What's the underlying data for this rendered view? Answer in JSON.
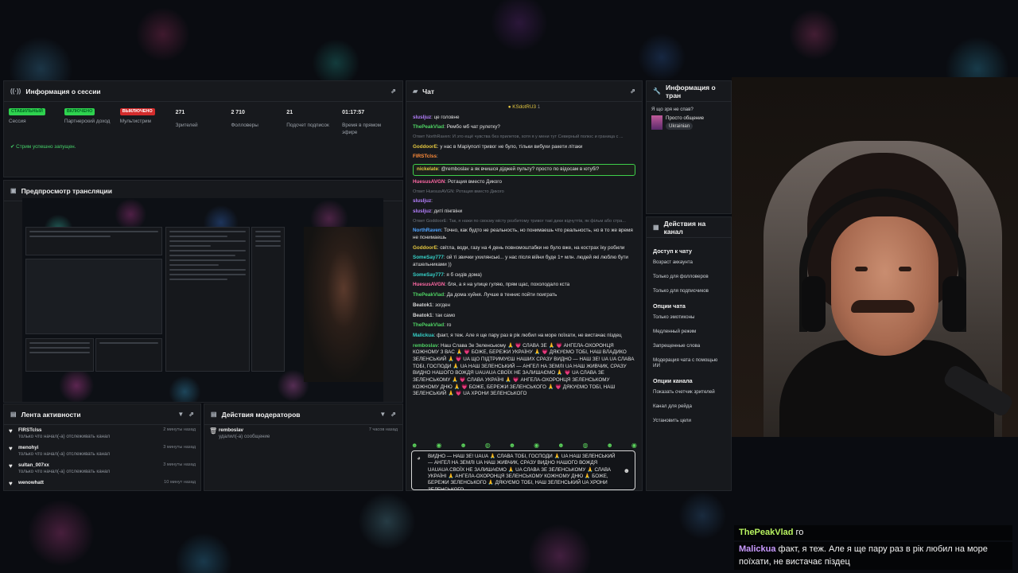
{
  "session": {
    "title": "Информация о сессии",
    "stats": [
      {
        "badge": "СТАБИЛЬНЫЙ",
        "badge_color": "#2fd24f",
        "label": "Сессия"
      },
      {
        "badge": "ВКЛЮЧЕНО",
        "badge_color": "#2fd24f",
        "label": "Партнерский доход"
      },
      {
        "badge": "ВЫКЛЮЧЕНО",
        "badge_color": "#d32c2c",
        "label": "Мультистрим"
      },
      {
        "value": "271",
        "label": "Зрителей"
      },
      {
        "value": "2 710",
        "label": "Фолловеры"
      },
      {
        "value": "21",
        "label": "Подсчет подписок"
      },
      {
        "value": "01:17:57",
        "label": "Время в прямом эфире"
      }
    ],
    "status": "Стрим успешно запущен."
  },
  "preview": {
    "title": "Предпросмотр трансляции"
  },
  "activity": {
    "title": "Лента активности",
    "items": [
      {
        "user": "FIRSTclss",
        "action": "только что начал(-а) отслеживать канал",
        "time": "2 минуты назад"
      },
      {
        "user": "menohyi",
        "action": "только что начал(-а) отслеживать канал",
        "time": "3 минуты назад"
      },
      {
        "user": "sultan_007xx",
        "action": "только что начал(-а) отслеживать канал",
        "time": "3 минуты назад"
      },
      {
        "user": "wenowhatt",
        "action": "",
        "time": "10 минут назад"
      }
    ]
  },
  "mod_actions": {
    "title": "Действия модераторов",
    "items": [
      {
        "user": "remboslav",
        "action": "удалил(-а) сообщение",
        "time": "7 часов назад"
      }
    ]
  },
  "chat": {
    "title": "Чат",
    "pinned": "KSdotRU3",
    "pinned_count": "1",
    "messages": [
      {
        "user": "slusljuz",
        "text": ": це головне",
        "color": "u-purple"
      },
      {
        "user": "ThePeakVlad",
        "text": ": Рембо мб чат рулетку?",
        "color": "u-green"
      },
      {
        "reply": "Ответ NorthRaven: И это ещё чувства без прилетов, хотя я у мени тут Северный полюс и граница с ..."
      },
      {
        "user": "GoddoorE",
        "text": ": у нас в Маріуполі тривог не було, тільки вибухи ракети літаки",
        "color": "u-yellow"
      },
      {
        "user": "FIRSTclss",
        "text": ":",
        "color": "u-orange"
      },
      {
        "user": "nickelate",
        "text": ": @remboslav а як вчишся діджей пульту? просто по відосам в ютубі?",
        "color": "u-yellow",
        "highlight": true
      },
      {
        "user": "HuesusAVGN",
        "text": ": Ротация вместо Дикого",
        "color": "u-pink"
      },
      {
        "reply": "Ответ HuesusAVGN: Ротация вместо Дикого"
      },
      {
        "user": "slusljuz",
        "text": ":",
        "color": "u-purple"
      },
      {
        "user": "slusljuz",
        "text": ": диті пінгвіни",
        "color": "u-purple"
      },
      {
        "reply": "Ответ GoddoorE: Так, я нажи по своєму місту розбитому тривог такі дики відчуттів, як фільм або стра..."
      },
      {
        "user": "NorthRaven",
        "text": ": Точно, как будто не реальность, но понимаешь что реальность, но в то же время не понимаешь",
        "color": "u-blue"
      },
      {
        "user": "GoddoorE",
        "text": ": світла, води, газу на 4 день повномоштабки не було вже, на кострах їку робили",
        "color": "u-yellow"
      },
      {
        "user": "SomeSay777",
        "text": ": ой ті звички ухилянські... у нас після війни буде 1+ млн. людей які люблю бути атшельниками ))",
        "color": "u-teal"
      },
      {
        "user": "SomeSay777",
        "text": ": я б сидів дома)",
        "color": "u-teal"
      },
      {
        "user": "HuesusAVGN",
        "text": ": бля, а я на улице гуляю, прям щас, похолодало кста",
        "color": "u-pink"
      },
      {
        "user": "ThePeakVlad",
        "text": ": Да дома хуйня. Лучше в теннис пойти поиграть",
        "color": "u-green"
      },
      {
        "user": "Beatok1",
        "text": ": зогден",
        "color": "u-grey"
      },
      {
        "user": "Beatok1",
        "text": ": так само",
        "color": "u-grey"
      },
      {
        "user": "ThePeakVlad",
        "text": ": го",
        "color": "u-green"
      },
      {
        "user": "Malickua",
        "text": ": факт, я теж. Але я ще пару раз в рік любил на море поїхати, не вистачає піздец",
        "color": "u-teal"
      },
      {
        "user": "remboslav",
        "text": ": Наш Слава Зе Зеленському 🙏 💗 СЛАВА ЗЕ 🙏 💗 АНГЕЛА-ОХОРОНЦЯ КОЖНОМУ З ВАС 🙏 💗 БОЖЕ, БЕРЕЖИ УКРАЇНУ 🙏 💗 ДЯКУЄМО ТОБІ, НАШ ВЛАДИКО ЗЕЛЕНСЬКИЙ 🙏 💗 UA ЩО ПІДТРИМУЄШ НАШИХ СРАЗУ ВИДНО — НАШ ЗЕ! UA UA СЛАВА ТОБІ, ГОСПОДИ 🙏 UA НАШ ЗЕЛЕНСЬКИЙ — АНГЕЛ НА ЗЕМЛІ UA НАШ ЖИВЧИК, СРАЗУ ВИДНО НАШОГО ВОЖДЯ UAUAUA СВОЇХ НЕ ЗАЛИШАЄМО 🙏 💗 UA СЛАВА ЗЕ ЗЕЛЕНСЬКОМУ 🙏 💗 СЛАВА УКРАЇНІ 🙏 💗 АНГЕЛА-ОХОРОНЦЯ ЗЕЛЕНСЬКОМУ КОЖНОМУ ДНЮ 🙏 💗 БОЖЕ, БЕРЕЖИ ЗЕЛЕНСЬКОГО 🙏 💗 ДЯКУЄМО ТОБІ, НАШ ЗЕЛЕНСЬКИЙ 🙏 💗 UA ХРОНИ ЗЕЛЕНСЬКОГО",
        "color": "u-green"
      }
    ],
    "input_text": "ВИДНО — НАШ ЗЕ! UAUA 🙏 СЛАВА ТОБІ, ГОСПОДИ 🙏 UA НАШ ЗЕЛЕНСЬКИЙ — АНГЕЛ НА ЗЕМЛІ UA НАШ ЖИВЧИК, СРАЗУ ВИДНО НАШОГО ВОЖДЯ UAUAUA СВОЇХ НЕ ЗАЛИШАЄМО 🙏 UA СЛАВА ЗЕ ЗЕЛЕНСЬКОМУ 🙏 СЛАВА УКРАЇНІ 🙏 АНГЕЛА-ОХОРОНЦЯ ЗЕЛЕНСЬКОМУ КОЖНОМУ ДНЮ 🙏 БОЖЕ, БЕРЕЖИ ЗЕЛЕНСЬКОГО 🙏 ДЯКУЄМО ТОБІ, НАШ ЗЕЛЕНСЬКИЙ UA ХРОНИ ЗЕЛЕНСЬКОГО"
  },
  "stream_info": {
    "title": "Информация о тран",
    "question": "Я що зря не спав?",
    "category": "Просто общение",
    "tag": "Ukrainian"
  },
  "channel_actions": {
    "title": "Действия на канал",
    "sections": [
      {
        "heading": "Доступ к чату",
        "items": [
          "Возраст аккаунта",
          "Только для фолловеров",
          "Только для подписчиков"
        ]
      },
      {
        "heading": "Опции чата",
        "items": [
          "Только эмотиконы",
          "Медленный режим",
          "Запрещенные слова",
          "Модерация чата с помощью ИИ"
        ]
      },
      {
        "heading": "Опции канала",
        "items": [
          "Показать счетчик зрителей",
          "Канал для рейда",
          "Установить цели"
        ]
      }
    ]
  },
  "overlay_chat": [
    {
      "user": "ThePeakVlad",
      "text": " го"
    },
    {
      "user": "Malickua",
      "text": " факт, я теж. Але я ще пару раз в рік любил на море поїхати, не вистачає піздец"
    }
  ]
}
